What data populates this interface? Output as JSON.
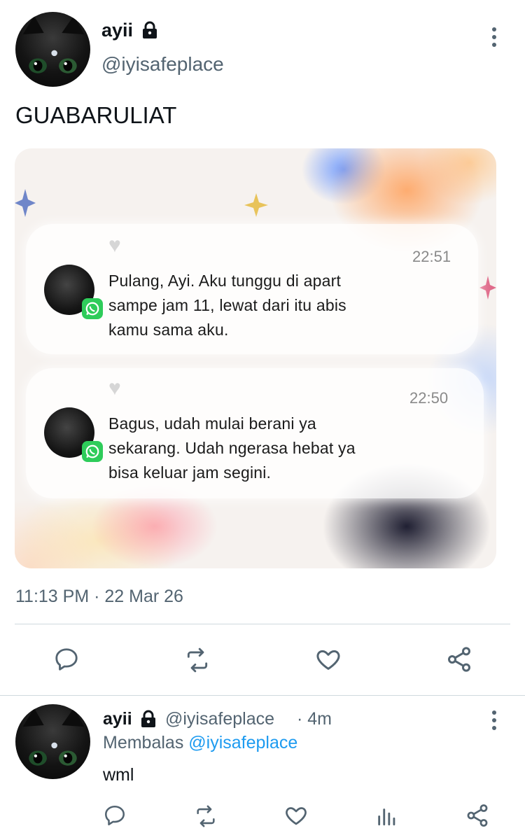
{
  "tweet": {
    "author_name": "ayii",
    "author_handle": "@iyisafeplace",
    "text": "GUABARULIAT",
    "timestamp": "11:13 PM · 22 Mar 26",
    "media": {
      "notifications": [
        {
          "time": "22:51",
          "line1": "Pulang, Ayi. Aku tunggu di apart",
          "line2": "sampe jam 11, lewat dari itu abis",
          "line3": "kamu sama aku."
        },
        {
          "time": "22:50",
          "line1": "Bagus, udah mulai berani ya",
          "line2": "sekarang. Udah ngerasa hebat ya",
          "line3": "bisa keluar jam segini."
        }
      ]
    },
    "actions": [
      "reply-icon",
      "retweet-icon",
      "like-icon",
      "share-icon"
    ]
  },
  "reply": {
    "author_name": "ayii",
    "author_handle": "@iyisafeplace",
    "age": "· 4m",
    "replying_prefix": "Membalas",
    "replying_to": "@iyisafeplace",
    "text": "wml",
    "actions": [
      "reply-icon",
      "retweet-icon",
      "like-icon",
      "views-icon",
      "share-icon"
    ]
  },
  "colors": {
    "text": "#0f1419",
    "secondary": "#536471",
    "link": "#1d9bf0",
    "divider": "#cfd9de",
    "whatsapp": "#2ecc5a"
  }
}
